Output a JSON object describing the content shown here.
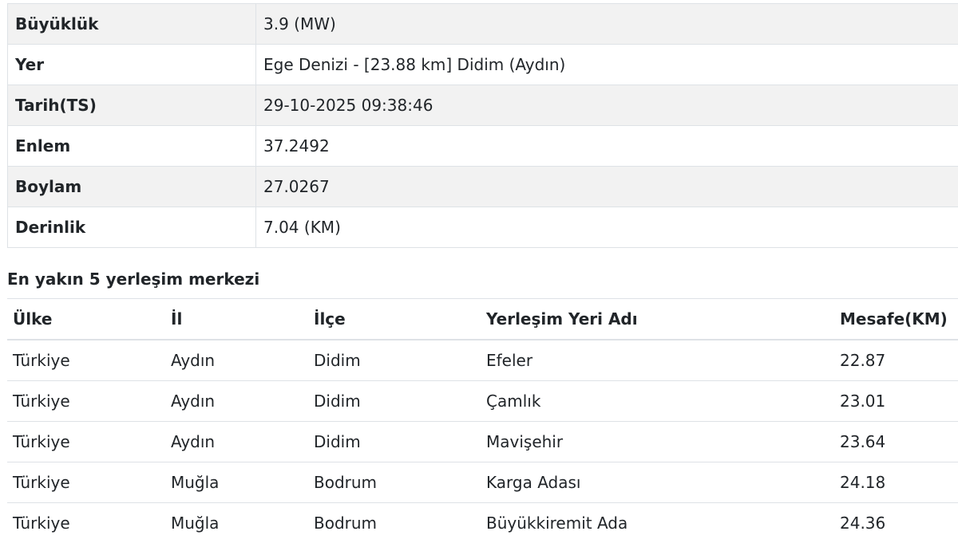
{
  "details": [
    {
      "label": "Büyüklük",
      "value": "3.9 (MW)"
    },
    {
      "label": "Yer",
      "value": "Ege Denizi - [23.88 km] Didim (Aydın)"
    },
    {
      "label": "Tarih(TS)",
      "value": "29-10-2025 09:38:46"
    },
    {
      "label": "Enlem",
      "value": "37.2492"
    },
    {
      "label": "Boylam",
      "value": "27.0267"
    },
    {
      "label": "Derinlik",
      "value": "7.04 (KM)"
    }
  ],
  "nearest": {
    "title": "En yakın 5 yerleşim merkezi",
    "headers": {
      "country": "Ülke",
      "province": "İl",
      "district": "İlçe",
      "settlement": "Yerleşim Yeri Adı",
      "distance": "Mesafe(KM)"
    },
    "rows": [
      {
        "country": "Türkiye",
        "province": "Aydın",
        "district": "Didim",
        "settlement": "Efeler",
        "distance": "22.87"
      },
      {
        "country": "Türkiye",
        "province": "Aydın",
        "district": "Didim",
        "settlement": "Çamlık",
        "distance": "23.01"
      },
      {
        "country": "Türkiye",
        "province": "Aydın",
        "district": "Didim",
        "settlement": "Mavişehir",
        "distance": "23.64"
      },
      {
        "country": "Türkiye",
        "province": "Muğla",
        "district": "Bodrum",
        "settlement": "Karga Adası",
        "distance": "24.18"
      },
      {
        "country": "Türkiye",
        "province": "Muğla",
        "district": "Bodrum",
        "settlement": "Büyükkiremit Ada",
        "distance": "24.36"
      }
    ]
  }
}
